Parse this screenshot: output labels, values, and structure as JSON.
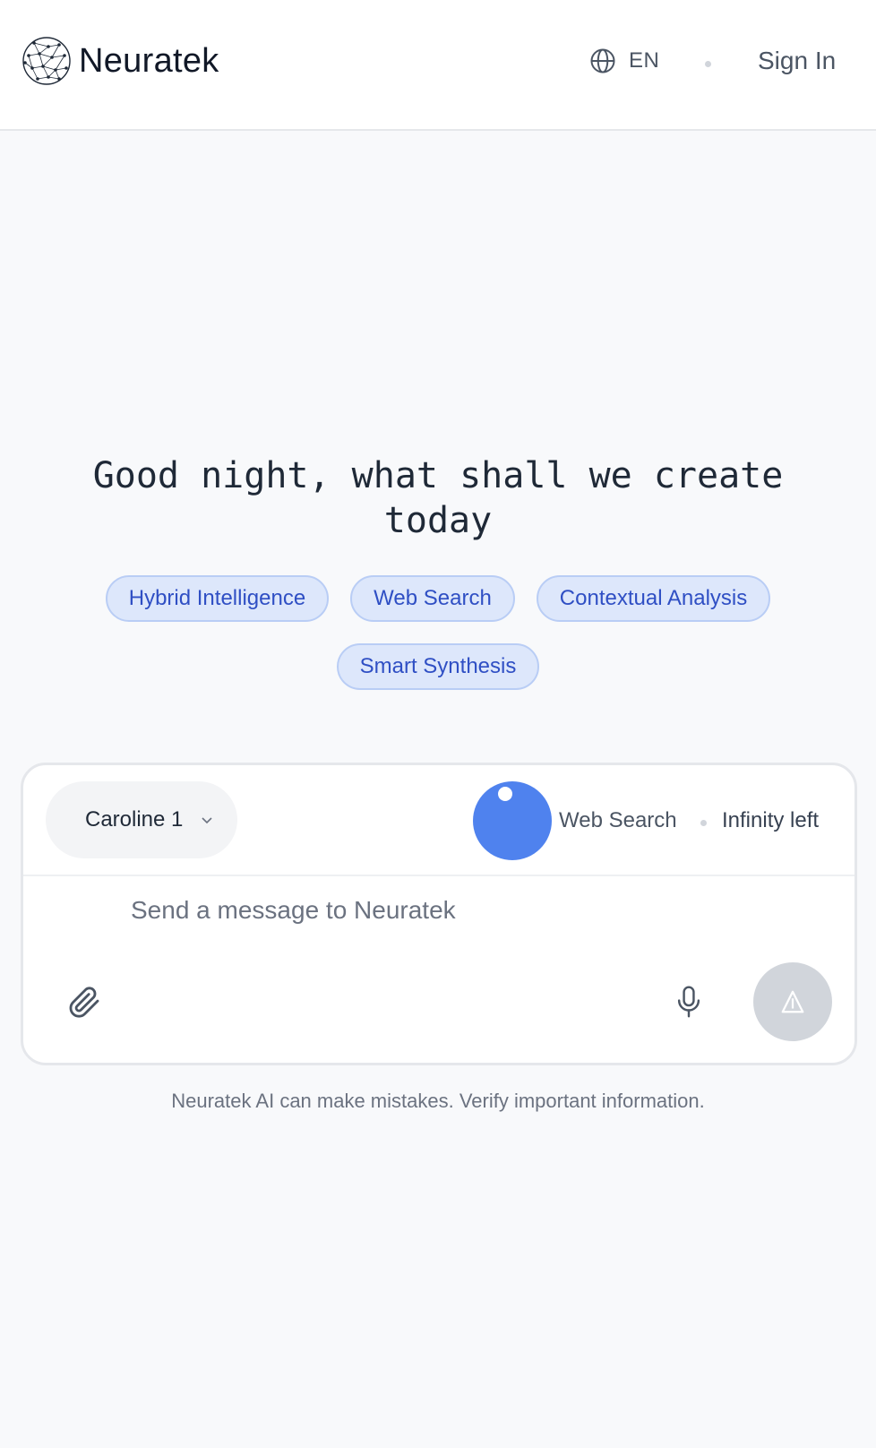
{
  "header": {
    "brand": "Neuratek",
    "language": "EN",
    "sign_in": "Sign In"
  },
  "hero": {
    "greeting": "Good night, what shall we create today"
  },
  "chips": [
    "Hybrid Intelligence",
    "Web Search",
    "Contextual Analysis",
    "Smart Synthesis"
  ],
  "composer": {
    "model": "Caroline 1",
    "web_search_label": "Web Search",
    "web_search_enabled": true,
    "credits": "Infinity left",
    "placeholder": "Send a message to Neuratek"
  },
  "icons": {
    "logo": "network-sphere-icon",
    "language": "globe-icon",
    "model_dropdown": "chevron-down-icon",
    "attach": "paperclip-icon",
    "voice": "microphone-icon",
    "send": "send-icon"
  },
  "colors": {
    "accent": "#4f82ee",
    "chip_background": "#dde7fb",
    "chip_text": "#2f4fc4",
    "send_disabled": "#d1d5db"
  },
  "footer": {
    "disclaimer": "Neuratek AI can make mistakes. Verify important information."
  }
}
